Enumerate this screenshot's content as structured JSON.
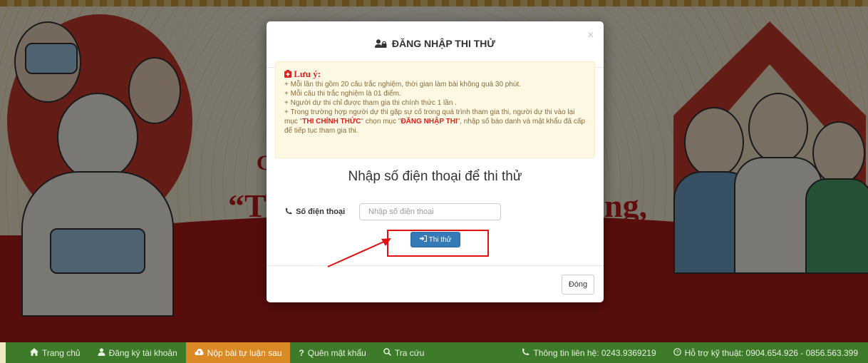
{
  "banner": {
    "slogan_left": "“Tì",
    "slogan_right": "ng,",
    "slogan_top": "C"
  },
  "modal": {
    "title": "ĐĂNG NHẬP THI THỬ",
    "close_symbol": "×",
    "notice": {
      "heading": "Lưu ý:",
      "line1": "+ Mỗi lần thi gồm 20 câu trắc nghiệm, thời gian làm bài không quá 30 phút.",
      "line2": "+ Mỗi câu thi trắc nghiệm là 01 điểm.",
      "line3": "+ Người dự thi chỉ được tham gia thi chính thức 1 lần .",
      "line4_a": "+ Trong trường hợp người dự thi gặp sự cố trong quá trình tham gia thi, người dự thi vào lại mục \"",
      "line4_hl1": "THI CHÍNH THỨC",
      "line4_b": "\" chọn mục \"",
      "line4_hl2": "ĐĂNG NHẬP THI",
      "line4_c": "\", nhập số báo danh và mật khẩu đã cấp để tiếp tục tham gia thi."
    },
    "form_title": "Nhập số điện thoại để thi thử",
    "phone_label": "Số điện thoại",
    "phone_placeholder": "Nhập số điện thoại",
    "phone_value": "",
    "submit_label": "Thi thử",
    "close_label": "Đóng"
  },
  "nav": {
    "items": [
      {
        "label": "Trang chủ",
        "icon": "home-icon"
      },
      {
        "label": "Đăng ký tài khoản",
        "icon": "user-icon"
      },
      {
        "label": "Nộp bài tự luận sau",
        "icon": "upload-icon"
      },
      {
        "label": "Quên mật khẩu",
        "icon": "question-icon"
      },
      {
        "label": "Tra cứu",
        "icon": "search-icon"
      }
    ],
    "contact": "Thông tin liên hệ: 0243.9369219",
    "support": "Hỗ trợ kỹ thuật: 0904.654.926 - 0856.563.399"
  },
  "colors": {
    "primary": "#337ab7",
    "nav_bg": "#3d7a2a",
    "nav_active": "#d98a25",
    "annotation": "#e01010",
    "notice_bg": "#fcf8e3"
  }
}
